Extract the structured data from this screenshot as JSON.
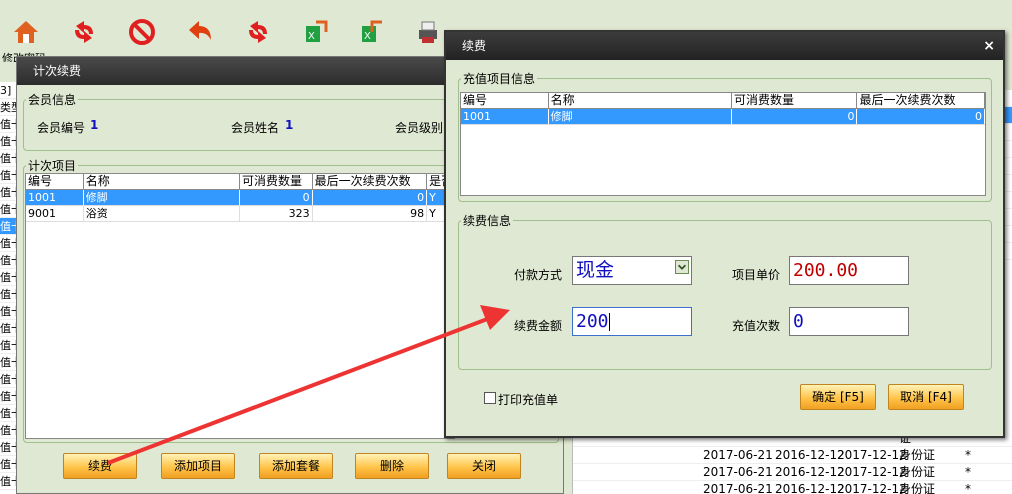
{
  "toolbar": {
    "first_label": "修改密码",
    "buttons": [
      {
        "icon": "home-icon",
        "color": "#e06020"
      },
      {
        "icon": "recycle-icon",
        "color": "#e02020"
      },
      {
        "icon": "forbidden-icon",
        "color": "#e02020"
      },
      {
        "icon": "back-arrow-icon",
        "color": "#e04010"
      },
      {
        "icon": "recycle-icon",
        "color": "#e02020"
      },
      {
        "icon": "excel-export-icon",
        "color": "#20a040"
      },
      {
        "icon": "excel-import-icon",
        "color": "#20a040"
      },
      {
        "icon": "printer-icon",
        "color": "#c03030"
      }
    ]
  },
  "bg_left": {
    "items": [
      "3]",
      "类型",
      "值卡",
      "值卡",
      "值卡",
      "值卡",
      "值卡",
      "值卡",
      "值卡",
      "值卡",
      "值卡",
      "值卡",
      "值卡",
      "值卡",
      "值卡",
      "值卡",
      "值卡",
      "值卡",
      "值卡",
      "值卡",
      "值卡",
      "值卡",
      "值卡",
      "值卡"
    ]
  },
  "bg_table": {
    "rows": [
      {
        "d1": "",
        "d2": "",
        "d3": "",
        "id": "证",
        "flag": ""
      },
      {
        "d1": "2017-06-21",
        "d2": "2016-12-12",
        "d3": "2017-12-12",
        "id": "身份证",
        "flag": "*"
      },
      {
        "d1": "2017-06-21",
        "d2": "2016-12-12",
        "d3": "2017-12-12",
        "id": "身份证",
        "flag": "*"
      },
      {
        "d1": "2017-06-21",
        "d2": "2016-12-12",
        "d3": "2017-12-12",
        "id": "身份证",
        "flag": "*"
      }
    ]
  },
  "win1": {
    "title": "计次续费",
    "member_group": "会员信息",
    "member_no_label": "会员编号",
    "member_no": "1",
    "member_name_label": "会员姓名",
    "member_name": "1",
    "member_level_label": "会员级别",
    "items_group": "计次项目",
    "columns": [
      "编号",
      "名称",
      "可消费数量",
      "最后一次续费次数",
      "是否"
    ],
    "rows": [
      {
        "code": "1001",
        "name": "修脚",
        "qty": "0",
        "last": "0",
        "flag": "Y"
      },
      {
        "code": "9001",
        "name": "浴资",
        "qty": "323",
        "last": "98",
        "flag": "Y"
      }
    ],
    "buttons": {
      "renew": "续费",
      "add_item": "添加项目",
      "add_package": "添加套餐",
      "delete": "删除",
      "close": "关闭"
    }
  },
  "win2": {
    "title": "续费",
    "close_glyph": "×",
    "recharge_group": "充值项目信息",
    "columns": [
      "编号",
      "名称",
      "可消费数量",
      "最后一次续费次数"
    ],
    "rows": [
      {
        "code": "1001",
        "name": "修脚",
        "qty": "0",
        "last": "0"
      }
    ],
    "renew_group": "续费信息",
    "pay_method_label": "付款方式",
    "pay_method": "现金",
    "unit_price_label": "项目单价",
    "unit_price": "200.00",
    "amount_label": "续费金额",
    "amount": "200",
    "count_label": "充值次数",
    "count": "0",
    "print_label": "打印充值单",
    "ok_button": "确定 [F5]",
    "cancel_button": "取消 [F4]"
  },
  "colors": {
    "accent_blue": "#3399ff",
    "value_blue": "#1010c0",
    "value_red": "#c00000",
    "arrow": "#ee3333"
  }
}
